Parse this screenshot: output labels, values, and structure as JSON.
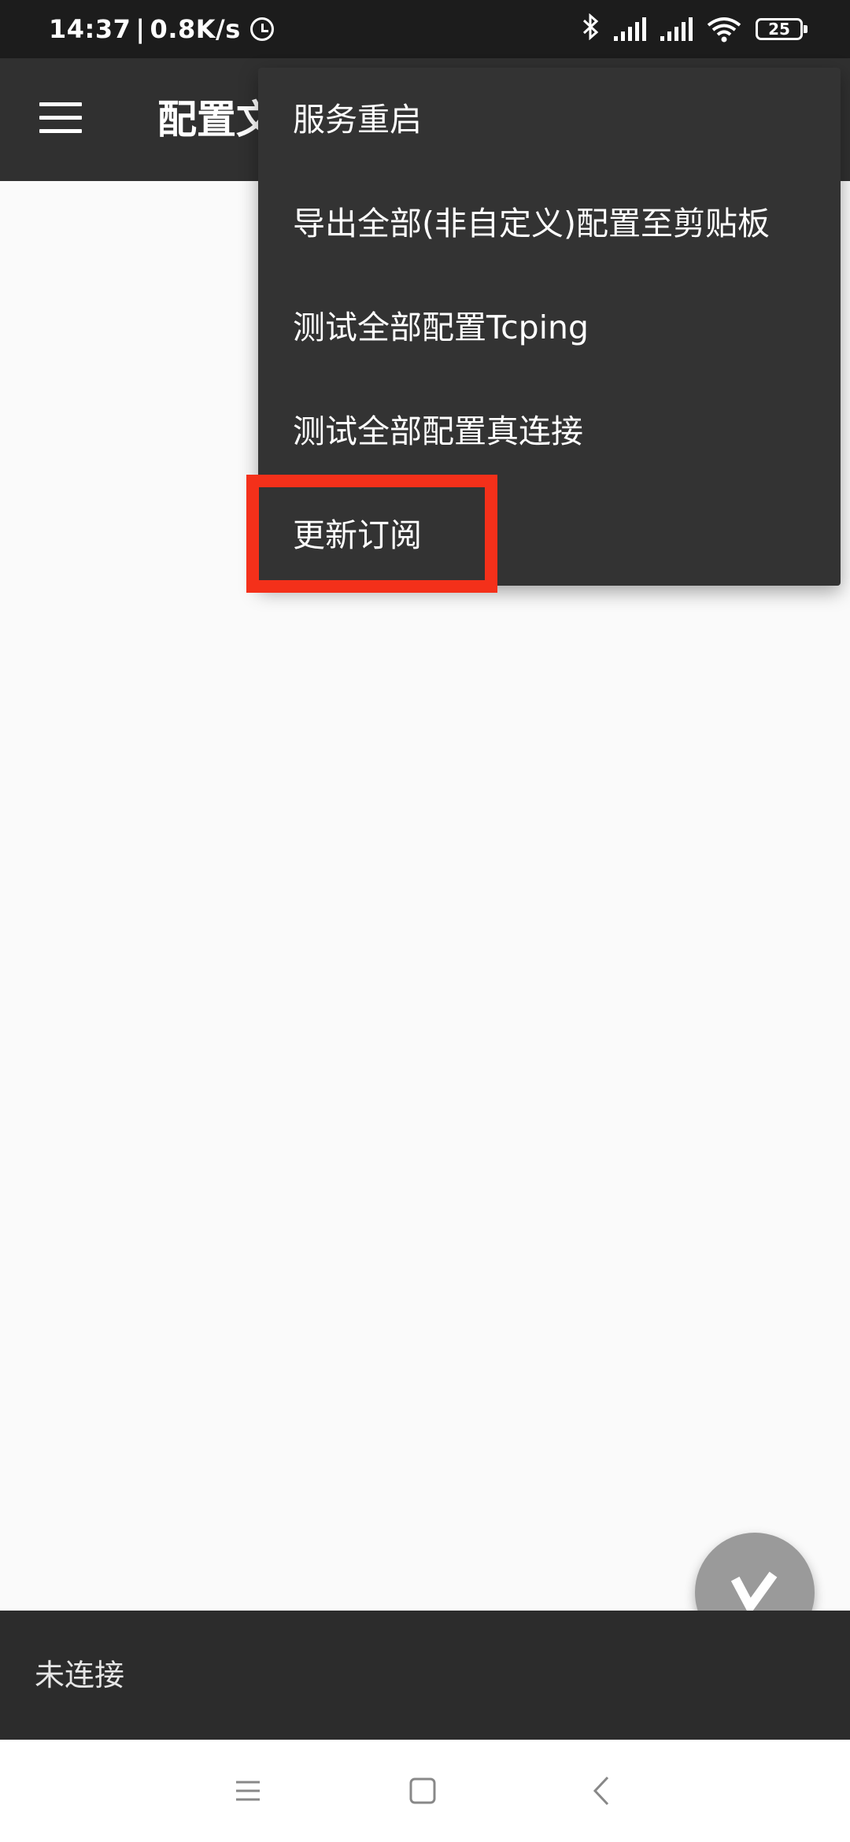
{
  "status_bar": {
    "time": "14:37",
    "separator": "|",
    "net_speed": "0.8K/s",
    "battery_level": "25",
    "icons": [
      "alarm-clock-icon",
      "bluetooth-icon",
      "signal-icon",
      "signal-icon",
      "wifi-icon",
      "battery-icon"
    ]
  },
  "app_bar": {
    "title": "配置文件"
  },
  "overflow_menu": {
    "items": [
      {
        "label": "服务重启"
      },
      {
        "label": "导出全部(非自定义)配置至剪贴板"
      },
      {
        "label": "测试全部配置Tcping"
      },
      {
        "label": "测试全部配置真连接"
      },
      {
        "label": "更新订阅"
      }
    ],
    "highlighted_index": 4
  },
  "bottom_panel": {
    "status": "未连接"
  },
  "colors": {
    "status_bar_bg": "#1c1c1c",
    "app_bar_bg": "#303030",
    "menu_bg": "#333333",
    "content_bg": "#fafafa",
    "bottom_panel_bg": "#2c2c2c",
    "fab_bg": "#9a9a9a",
    "highlight": "#f4301a"
  }
}
